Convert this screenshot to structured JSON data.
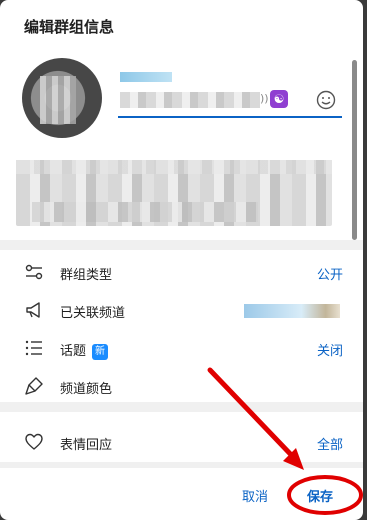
{
  "dialog": {
    "title": "编辑群组信息"
  },
  "profile": {
    "name_suffix": "))"
  },
  "settings": {
    "items": [
      {
        "label": "群组类型",
        "value": "公开"
      },
      {
        "label": "已关联频道",
        "value": ""
      },
      {
        "label": "话题",
        "badge": "新",
        "value": "关闭"
      },
      {
        "label": "频道颜色",
        "value": ""
      }
    ],
    "reaction": {
      "label": "表情回应",
      "value": "全部"
    }
  },
  "footer": {
    "cancel_label": "取消",
    "save_label": "保存"
  },
  "colors": {
    "accent": "#0b63c5",
    "annotation": "#e00000"
  },
  "icons": {
    "group_type": "toggle-sliders-icon",
    "linked_channel": "megaphone-icon",
    "topics": "list-icon",
    "channel_color": "paintbrush-icon",
    "reactions": "heart-icon",
    "emoji": "smiley-icon"
  }
}
